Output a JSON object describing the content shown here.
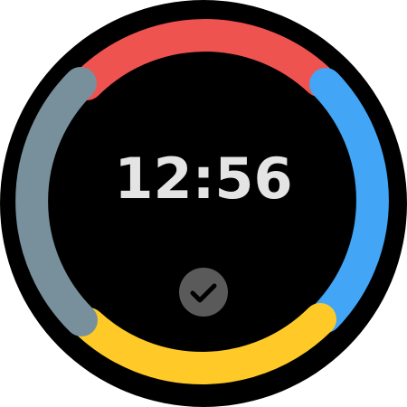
{
  "watch_face": {
    "time": "12:56",
    "bezel_color": "#000000",
    "time_color": "#e4e4e4",
    "complication": {
      "icon": "check-icon",
      "background": "#5a5a5a",
      "icon_color": "#000000"
    },
    "ring_segments": [
      {
        "name": "top",
        "color": "#ef5350"
      },
      {
        "name": "right",
        "color": "#42a5f5"
      },
      {
        "name": "bottom",
        "color": "#ffca28"
      },
      {
        "name": "left",
        "color": "#78909c"
      }
    ]
  }
}
